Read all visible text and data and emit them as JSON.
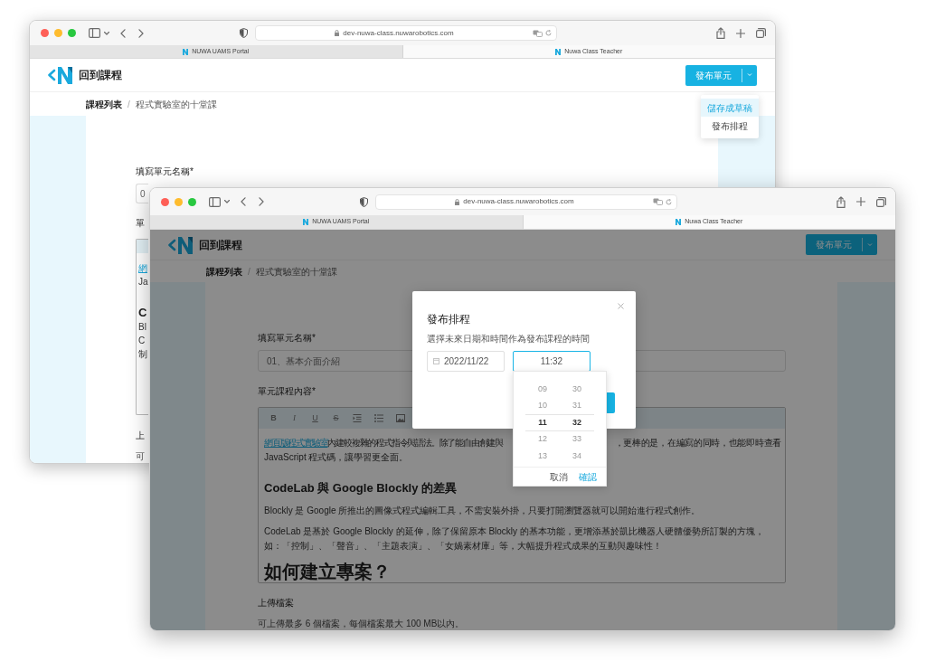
{
  "back_window": {
    "address": "dev-nuwa-class.nuwarobotics.com",
    "tabs": [
      {
        "label": "NUWA UAMS Portal",
        "selected": false
      },
      {
        "label": "Nuwa Class Teacher",
        "selected": true
      }
    ],
    "back_link": "回到課程",
    "publish_button": "發布單元",
    "publish_menu": [
      {
        "label": "儲存成草稿",
        "selected": true
      },
      {
        "label": "發布排程",
        "selected": false
      }
    ],
    "breadcrumbs": [
      "課程列表",
      "程式實驗室的十堂課"
    ],
    "name_label": "填寫單元名稱*",
    "name_value": "0",
    "content_label": "單",
    "editor_fragments": [
      {
        "kind": "link",
        "text": "網"
      },
      {
        "kind": "text",
        "text": "Ja"
      },
      {
        "kind": "heading",
        "text": "C"
      },
      {
        "kind": "text",
        "text": "Bl"
      },
      {
        "kind": "text",
        "text": "C"
      },
      {
        "kind": "text",
        "text": "制"
      }
    ],
    "upload_label": "上",
    "upload_note": "可",
    "breadcrumb_separator": "/"
  },
  "front_window": {
    "address": "dev-nuwa-class.nuwarobotics.com",
    "tabs": [
      {
        "label": "NUWA UAMS Portal",
        "selected": false
      },
      {
        "label": "Nuwa Class Teacher",
        "selected": true
      }
    ],
    "back_link": "回到課程",
    "publish_button": "發布單元",
    "breadcrumbs": [
      "課程列表",
      "程式實驗室的十堂課"
    ],
    "name_label": "填寫單元名稱*",
    "name_value": "01、基本介面介紹",
    "content_label": "單元課程內容*",
    "editor_toolbar": [
      {
        "kind": "bold",
        "label": "B"
      },
      {
        "kind": "italic",
        "label": "I"
      },
      {
        "kind": "underline",
        "label": "U"
      },
      {
        "kind": "strike",
        "label": "S"
      },
      {
        "kind": "indent"
      },
      {
        "kind": "list"
      },
      {
        "kind": "image"
      }
    ],
    "editor_blocks": [
      {
        "kind": "split_paragraph",
        "link": "網頁版程式實驗室",
        "left": " 內建較複雜的程式指令與語法。除了能自由創建與",
        "right": "，更棒的是，在編寫的同時，也能即時查看",
        "rest": "JavaScript 程式碼，讓學習更全面。"
      },
      {
        "kind": "heading",
        "text": "CodeLab 與 Google Blockly 的差異"
      },
      {
        "kind": "paragraph",
        "text": "Blockly 是 Google 所推出的圖像式程式編輯工具，不需安裝外掛，只要打開瀏覽器就可以開始進行程式創作。"
      },
      {
        "kind": "paragraph",
        "text": "CodeLab 是基於 Google Blockly 的延伸，除了保留原本 Blockly 的基本功能，更增添基於凱比機器人硬體優勢所訂製的方塊，如：「控制」、「聲音」、「主題表演」、「女媧素材庫」等，大幅提升程式成果的互動與趣味性！"
      },
      {
        "kind": "title",
        "text": "如何建立專案？"
      }
    ],
    "upload_label": "上傳檔案",
    "upload_note": "可上傳最多 6 個檔案，每個檔案最大 100 MB以內。",
    "breadcrumb_separator": "/",
    "modal": {
      "title": "發布排程",
      "description": "選擇未來日期和時間作為發布課程的時間",
      "date": "2022/11/22",
      "time": "11:32",
      "time_picker": {
        "hours": [
          {
            "label": "09",
            "selected": false
          },
          {
            "label": "10",
            "selected": false
          },
          {
            "label": "11",
            "selected": true
          },
          {
            "label": "12",
            "selected": false
          },
          {
            "label": "13",
            "selected": false
          }
        ],
        "minutes": [
          {
            "label": "30",
            "selected": false
          },
          {
            "label": "31",
            "selected": false
          },
          {
            "label": "32",
            "selected": true
          },
          {
            "label": "33",
            "selected": false
          },
          {
            "label": "34",
            "selected": false
          }
        ],
        "cancel": "取消",
        "confirm": "確認"
      }
    }
  }
}
